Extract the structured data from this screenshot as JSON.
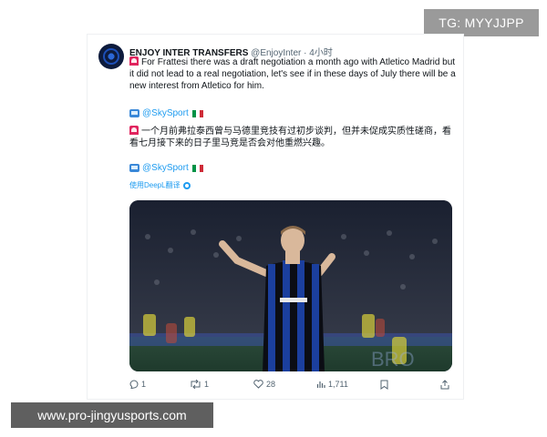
{
  "overlay": {
    "tg_label": "TG: MYYJJPP",
    "site_url": "www.pro-jingyusports.com"
  },
  "tweet": {
    "author_name": "ENJOY INTER TRANSFERS",
    "handle": "@EnjoyInter",
    "separator": "·",
    "time": "4小时",
    "text_en": "For Frattesi there was a draft negotiation a month ago with Atletico Madrid but it did not lead to a real negotiation, let's see if in these days of July there will be a new interest from Atletico for him.",
    "source_1": "@SkySport",
    "text_zh": "一个月前弗拉泰西曾与马德里竞技有过初步谈判，但并未促成实质性磋商，看看七月接下来的日子里马竞是否会对他重燃兴趣。",
    "source_2": "@SkySport",
    "translate_label": "使用DeepL翻译",
    "stats": {
      "replies": "1",
      "reposts": "1",
      "likes": "28",
      "views": "1,711"
    }
  },
  "icons": {
    "emoji": [
      "siren-icon",
      "tv-icon",
      "italy-flag-icon",
      "deepl-icon"
    ],
    "actions": [
      "reply-icon",
      "repost-icon",
      "like-icon",
      "views-icon",
      "bookmark-icon",
      "share-icon"
    ]
  },
  "colors": {
    "link": "#1d9bf0",
    "muted": "#536471",
    "kit_blue": "#1b3f9e",
    "kit_black": "#0b0d14"
  }
}
